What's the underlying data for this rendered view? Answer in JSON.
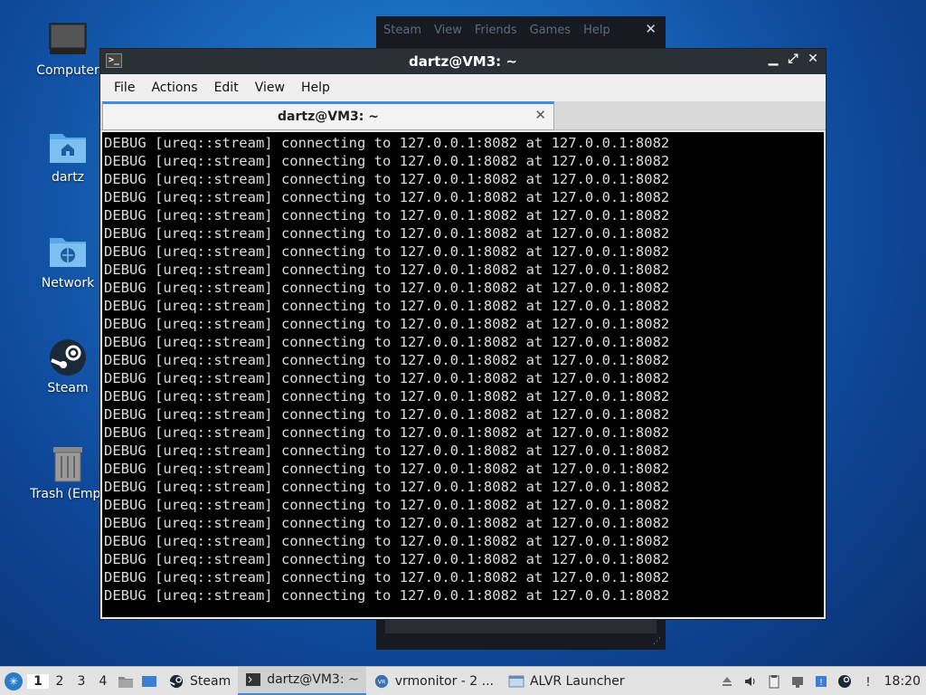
{
  "desktop": {
    "icons": [
      {
        "label": "Computer"
      },
      {
        "label": "dartz"
      },
      {
        "label": "Network"
      },
      {
        "label": "Steam"
      },
      {
        "label": "Trash (Empt"
      }
    ]
  },
  "steam_window": {
    "menu": [
      "Steam",
      "View",
      "Friends",
      "Games",
      "Help"
    ]
  },
  "terminal": {
    "window_title": "dartz@VM3: ~",
    "menu": [
      "File",
      "Actions",
      "Edit",
      "View",
      "Help"
    ],
    "tab_label": "dartz@VM3: ~",
    "lines": [
      "DEBUG [ureq::stream] connecting to 127.0.0.1:8082 at 127.0.0.1:8082",
      "DEBUG [ureq::stream] connecting to 127.0.0.1:8082 at 127.0.0.1:8082",
      "DEBUG [ureq::stream] connecting to 127.0.0.1:8082 at 127.0.0.1:8082",
      "DEBUG [ureq::stream] connecting to 127.0.0.1:8082 at 127.0.0.1:8082",
      "DEBUG [ureq::stream] connecting to 127.0.0.1:8082 at 127.0.0.1:8082",
      "DEBUG [ureq::stream] connecting to 127.0.0.1:8082 at 127.0.0.1:8082",
      "DEBUG [ureq::stream] connecting to 127.0.0.1:8082 at 127.0.0.1:8082",
      "DEBUG [ureq::stream] connecting to 127.0.0.1:8082 at 127.0.0.1:8082",
      "DEBUG [ureq::stream] connecting to 127.0.0.1:8082 at 127.0.0.1:8082",
      "DEBUG [ureq::stream] connecting to 127.0.0.1:8082 at 127.0.0.1:8082",
      "DEBUG [ureq::stream] connecting to 127.0.0.1:8082 at 127.0.0.1:8082",
      "DEBUG [ureq::stream] connecting to 127.0.0.1:8082 at 127.0.0.1:8082",
      "DEBUG [ureq::stream] connecting to 127.0.0.1:8082 at 127.0.0.1:8082",
      "DEBUG [ureq::stream] connecting to 127.0.0.1:8082 at 127.0.0.1:8082",
      "DEBUG [ureq::stream] connecting to 127.0.0.1:8082 at 127.0.0.1:8082",
      "DEBUG [ureq::stream] connecting to 127.0.0.1:8082 at 127.0.0.1:8082",
      "DEBUG [ureq::stream] connecting to 127.0.0.1:8082 at 127.0.0.1:8082",
      "DEBUG [ureq::stream] connecting to 127.0.0.1:8082 at 127.0.0.1:8082",
      "DEBUG [ureq::stream] connecting to 127.0.0.1:8082 at 127.0.0.1:8082",
      "DEBUG [ureq::stream] connecting to 127.0.0.1:8082 at 127.0.0.1:8082",
      "DEBUG [ureq::stream] connecting to 127.0.0.1:8082 at 127.0.0.1:8082",
      "DEBUG [ureq::stream] connecting to 127.0.0.1:8082 at 127.0.0.1:8082",
      "DEBUG [ureq::stream] connecting to 127.0.0.1:8082 at 127.0.0.1:8082",
      "DEBUG [ureq::stream] connecting to 127.0.0.1:8082 at 127.0.0.1:8082",
      "DEBUG [ureq::stream] connecting to 127.0.0.1:8082 at 127.0.0.1:8082",
      "DEBUG [ureq::stream] connecting to 127.0.0.1:8082 at 127.0.0.1:8082"
    ]
  },
  "taskbar": {
    "workspaces": [
      "1",
      "2",
      "3",
      "4"
    ],
    "active_workspace": "1",
    "tasks": [
      {
        "label": "Steam",
        "icon": "steam-icon"
      },
      {
        "label": "dartz@VM3: ~",
        "icon": "terminal-icon",
        "active": true
      },
      {
        "label": "vrmonitor - 2 ...",
        "icon": "vrmonitor-icon"
      },
      {
        "label": "ALVR Launcher",
        "icon": "window-icon"
      }
    ],
    "clock": "18:20"
  },
  "colors": {
    "accent": "#3b8ddb",
    "terminal_bg": "#000000",
    "terminal_fg": "#dcdcdc",
    "titlebar_bg": "#2b2f36"
  }
}
